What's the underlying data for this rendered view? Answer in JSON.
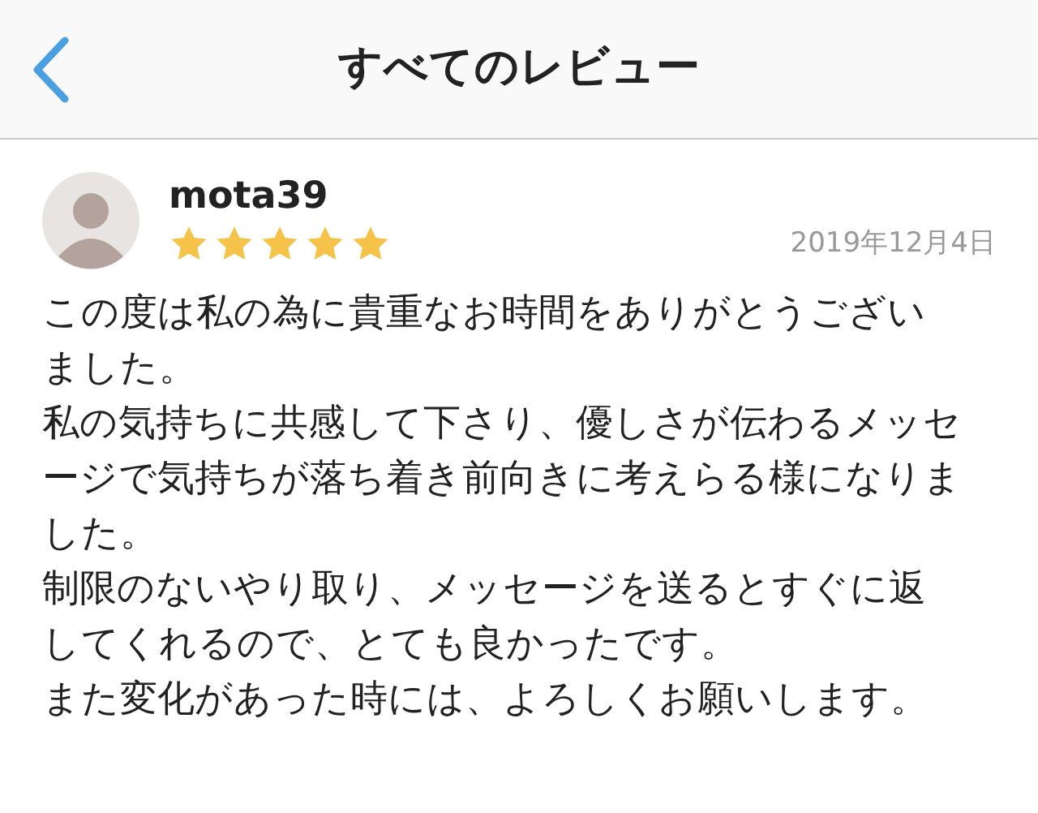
{
  "header": {
    "title": "すべてのレビュー"
  },
  "review": {
    "user": "mota39",
    "stars": 5,
    "date": "2019年12月4日",
    "paragraphs": [
      "この度は私の為に貴重なお時間をありがとうございました。",
      "私の気持ちに共感して下さり、優しさが伝わるメッセージで気持ちが落ち着き前向きに考えらる様になりました。",
      "制限のないやり取り、メッセージを送るとすぐに返してくれるので、とても良かったです。",
      "また変化があった時には、よろしくお願いします。"
    ]
  }
}
